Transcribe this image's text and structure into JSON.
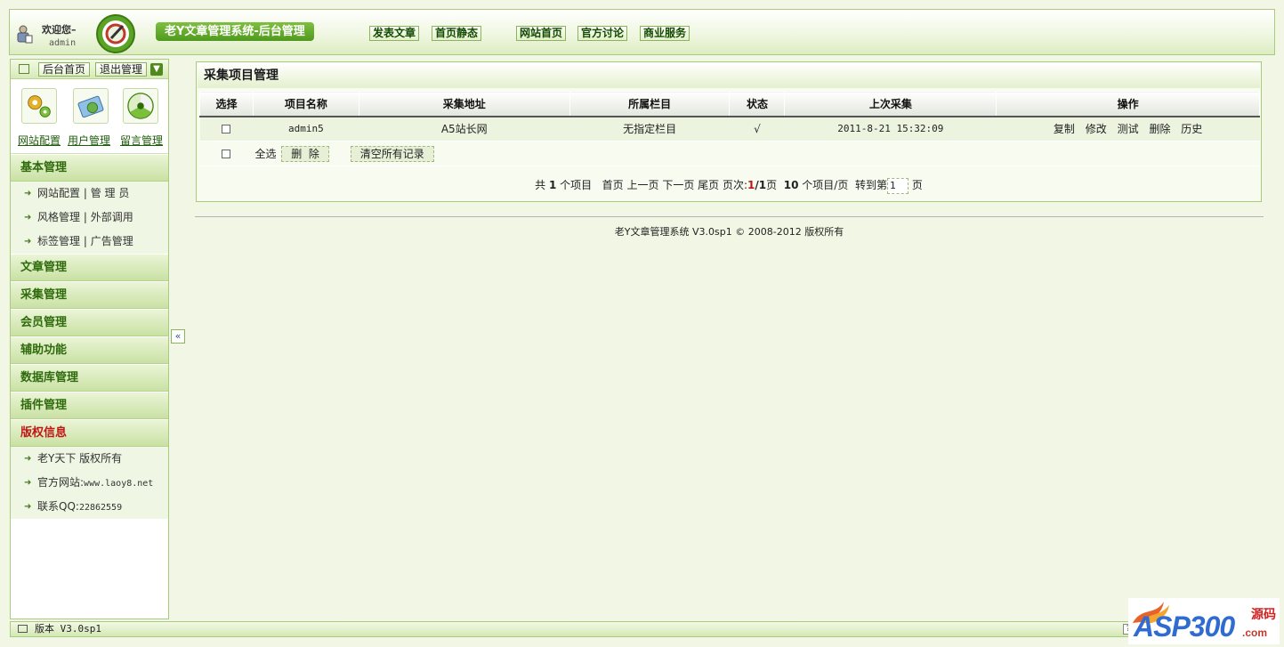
{
  "header": {
    "welcome": "欢迎您–",
    "user": "admin",
    "system_title": "老Y文章管理系统-后台管理",
    "nav": [
      "发表文章",
      "首页静态",
      "网站首页",
      "官方讨论",
      "商业服务"
    ]
  },
  "sidebar": {
    "tools": [
      "后台首页",
      "退出管理"
    ],
    "quick": [
      "网站配置",
      "用户管理",
      "留言管理"
    ],
    "basic": {
      "title": "基本管理",
      "items": [
        {
          "a": "网站配置",
          "b": "管 理 员"
        },
        {
          "a": "风格管理",
          "b": "外部调用"
        },
        {
          "a": "标签管理",
          "b": "广告管理"
        }
      ]
    },
    "sections": [
      "文章管理",
      "采集管理",
      "会员管理",
      "辅助功能",
      "数据库管理",
      "插件管理"
    ],
    "copyright": {
      "title": "版权信息",
      "lines": [
        {
          "label": "老Y天下 版权所有",
          "mono": ""
        },
        {
          "label": "官方网站:",
          "mono": "www.laoy8.net"
        },
        {
          "label": "联系QQ:",
          "mono": "22862559"
        }
      ]
    },
    "collapse": "«"
  },
  "main": {
    "title": "采集项目管理",
    "columns": [
      "选择",
      "项目名称",
      "采集地址",
      "所属栏目",
      "状态",
      "上次采集",
      "操作"
    ],
    "rows": [
      {
        "name": "admin5",
        "url": "A5站长网",
        "column": "无指定栏目",
        "status": "√",
        "last": "2011-8-21 15:32:09",
        "ops": [
          "复制",
          "修改",
          "测试",
          "删除",
          "历史"
        ]
      }
    ],
    "select_all": "全选",
    "delete_btn": "删  除",
    "clear_btn": "清空所有记录",
    "pager": {
      "p1": "共 ",
      "total": "1",
      "p2": " 个项目  ",
      "first": "首页",
      "prev": "上一页",
      "next": "下一页",
      "last": "尾页",
      "p3": " 页次:",
      "cur": "1",
      "slash": "/",
      "pages": "1",
      "p4": "页  ",
      "per": "10",
      "p5": " 个项目/页  ",
      "goto": "转到第",
      "input": "1",
      "p6": "页"
    }
  },
  "footer": {
    "copyright": "老Y文章管理系统 V3.0sp1 © 2008-2012 版权所有"
  },
  "statusbar": {
    "version": "版本 V3.0sp1",
    "help": "?"
  },
  "watermark": {
    "text": "ASP300",
    "suffix": ".com",
    "cn": "源码"
  },
  "colors": {
    "accent": "#4f9a1e",
    "border": "#a9cc7c",
    "background": "#f1f7e4",
    "alert": "#c01616"
  }
}
